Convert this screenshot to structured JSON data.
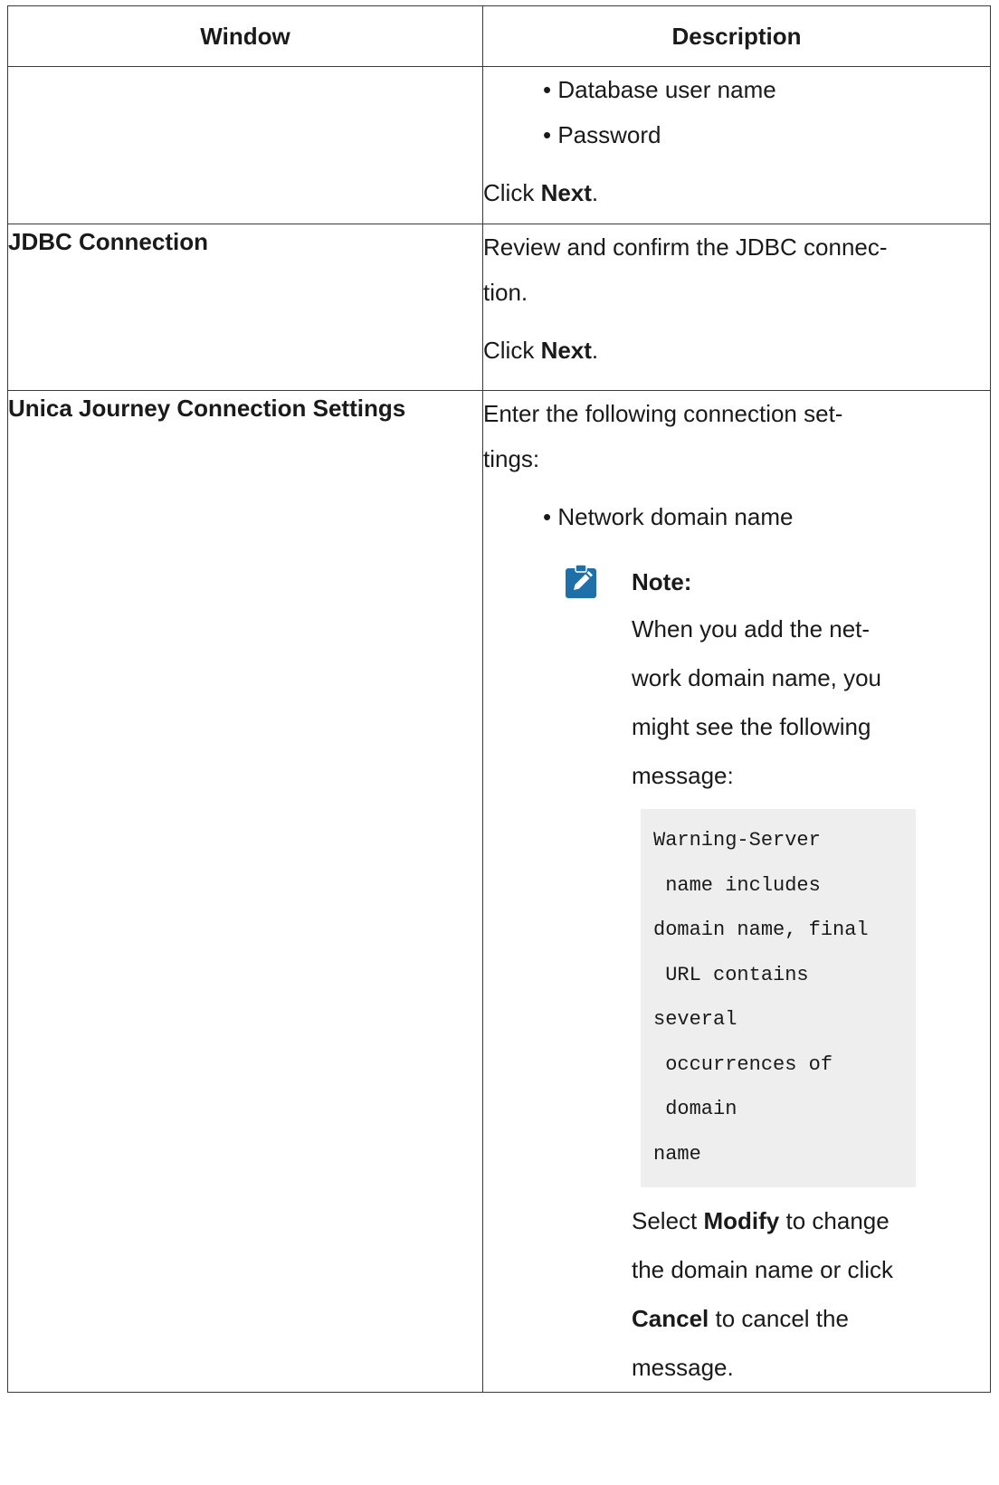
{
  "table": {
    "headers": {
      "window": "Window",
      "description": "Description"
    },
    "row1": {
      "window": "",
      "bullets": [
        "Database user name",
        "Password"
      ],
      "click_prefix": "Click ",
      "click_bold": "Next",
      "click_suffix": "."
    },
    "row2": {
      "window": "JDBC Connection",
      "text_line1": "Review and confirm the JDBC connec-",
      "text_line2": "tion.",
      "click_prefix": "Click ",
      "click_bold": "Next",
      "click_suffix": "."
    },
    "row3": {
      "window": "Unica Journey Connection Settings",
      "text_line1": "Enter the following connection set-",
      "text_line2": "tings:",
      "bullets": [
        "Network domain name"
      ],
      "note": {
        "icon": "pencil-note-icon",
        "icon_color": "#1f6fa8",
        "title": "Note:",
        "body_lines": [
          "When you add the net-",
          "work domain name, you",
          "might see the following",
          "message:"
        ],
        "code_lines": [
          "Warning-Server",
          " name includes",
          "domain name, final",
          " URL contains",
          "several",
          " occurrences of",
          " domain",
          "name"
        ],
        "after": {
          "t1": "Select ",
          "b1": "Modify",
          "t2": " to change",
          "line2": "the domain name or click",
          "b2": "Cancel",
          "t3": " to cancel the",
          "line4": "message."
        }
      }
    }
  }
}
